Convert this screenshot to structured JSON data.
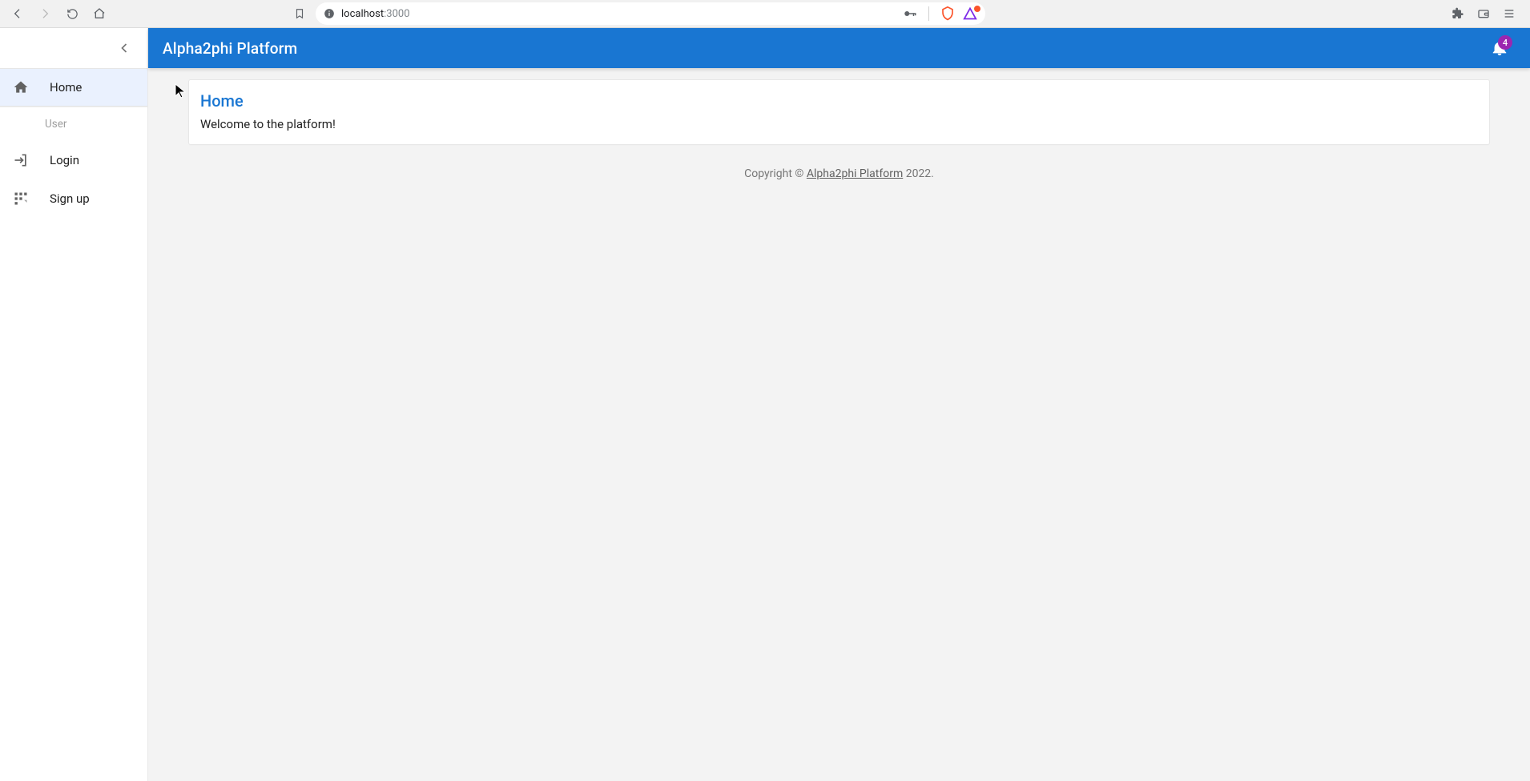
{
  "browser": {
    "url_host": "localhost",
    "url_port": ":3000"
  },
  "app": {
    "title": "Alpha2phi Platform",
    "notification_count": "4"
  },
  "sidebar": {
    "items": [
      {
        "label": "Home"
      }
    ],
    "user_heading": "User",
    "user_items": [
      {
        "label": "Login"
      },
      {
        "label": "Sign up"
      }
    ]
  },
  "home_card": {
    "title": "Home",
    "body": "Welcome to the platform!"
  },
  "footer": {
    "prefix": "Copyright © ",
    "link": "Alpha2phi Platform",
    "suffix": " 2022."
  }
}
